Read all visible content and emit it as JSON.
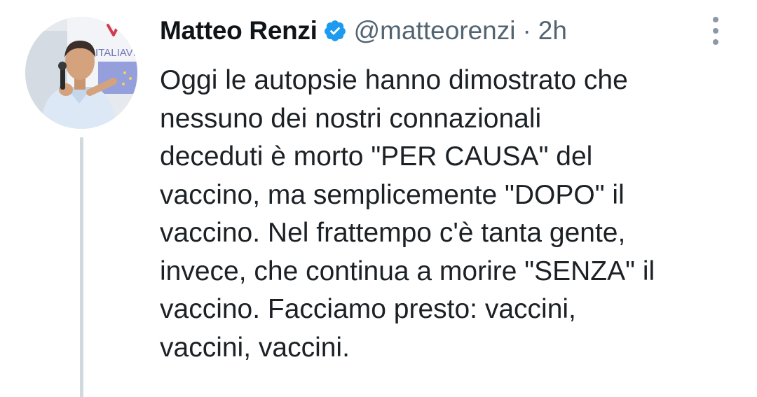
{
  "tweet": {
    "author": {
      "display_name": "Matteo Renzi",
      "handle": "@matteorenzi",
      "verified": true,
      "avatar_banner_text": "ITALIAVIVA"
    },
    "separator": "·",
    "timestamp": "2h",
    "text": "Oggi le autopsie hanno dimostrato che\nnessuno dei nostri connazionali\ndeceduti è morto \"PER CAUSA\" del\nvaccino, ma semplicemente \"DOPO\" il\nvaccino. Nel frattempo c'è tanta gente,\ninvece, che continua a morire \"SENZA\" il\nvaccino. Facciamo presto: vaccini,\nvaccini, vaccini."
  },
  "icons": {
    "verified": "verified-badge-icon",
    "more": "more-vertical-icon"
  },
  "colors": {
    "verified_blue": "#1d9bf0",
    "secondary_text": "#536471",
    "thread_line": "#cfd9de"
  }
}
